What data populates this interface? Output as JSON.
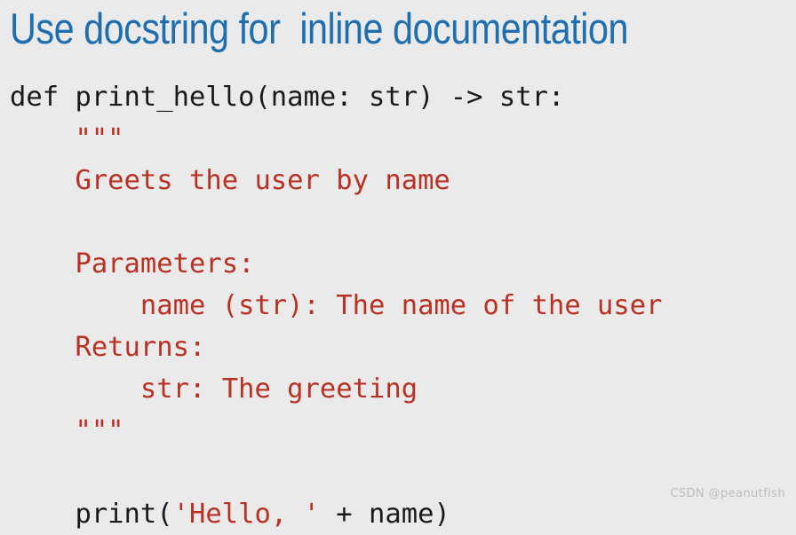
{
  "slide": {
    "background_color": "#eaeaea",
    "title": {
      "text": "Use docstring for  inline documentation",
      "color": "#1f6fb0"
    },
    "watermark": {
      "text": "CSDN @peanutfish",
      "color": "#bdbdbd"
    }
  },
  "colors": {
    "code_plain": "#1a1a1a",
    "code_string": "#b93123",
    "title_blue": "#1f6fb0",
    "background": "#eaeaea",
    "watermark_gray": "#bdbdbd"
  },
  "code": {
    "language": "python",
    "full_text": "def print_hello(name: str) -> str:\n    \"\"\"\n    Greets the user by name\n\n    Parameters:\n        name (str): The name of the user\n    Returns:\n        str: The greeting\n    \"\"\"\n\n    print('Hello, ' + name)",
    "lines": [
      {
        "id": "line-def",
        "segments": [
          {
            "kind": "plain",
            "text": "def print_hello(name: str) -> str:"
          }
        ]
      },
      {
        "id": "line-docstring-open",
        "segments": [
          {
            "kind": "doc",
            "text": "    \"\"\""
          }
        ]
      },
      {
        "id": "line-summary",
        "segments": [
          {
            "kind": "doc",
            "text": "    Greets the user by name"
          }
        ]
      },
      {
        "id": "line-blank-1",
        "segments": [
          {
            "kind": "plain",
            "text": ""
          }
        ]
      },
      {
        "id": "line-parameters-heading",
        "segments": [
          {
            "kind": "doc",
            "text": "    Parameters:"
          }
        ]
      },
      {
        "id": "line-parameter-name",
        "segments": [
          {
            "kind": "doc",
            "text": "        name (str): The name of the user"
          }
        ]
      },
      {
        "id": "line-returns-heading",
        "segments": [
          {
            "kind": "doc",
            "text": "    Returns:"
          }
        ]
      },
      {
        "id": "line-returns-value",
        "segments": [
          {
            "kind": "doc",
            "text": "        str: The greeting"
          }
        ]
      },
      {
        "id": "line-docstring-close",
        "segments": [
          {
            "kind": "doc",
            "text": "    \"\"\""
          }
        ]
      },
      {
        "id": "line-blank-2",
        "segments": [
          {
            "kind": "plain",
            "text": ""
          }
        ]
      },
      {
        "id": "line-print",
        "segments": [
          {
            "kind": "plain",
            "text": "    print("
          },
          {
            "kind": "string",
            "text": "'Hello, '"
          },
          {
            "kind": "plain",
            "text": " + name)"
          }
        ]
      }
    ]
  }
}
